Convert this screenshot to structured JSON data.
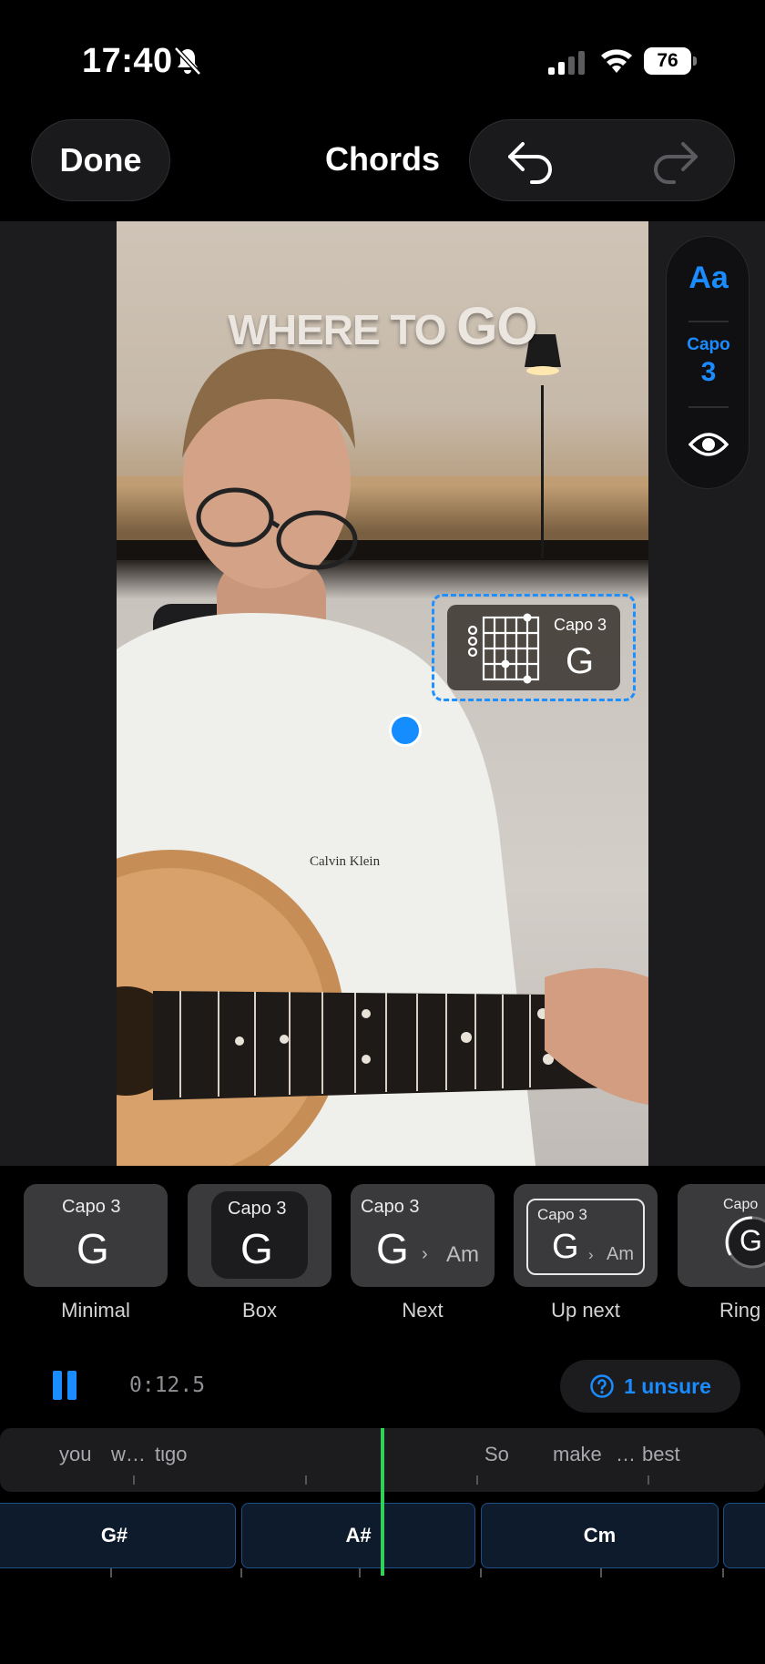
{
  "status": {
    "time": "17:40",
    "battery": "76"
  },
  "header": {
    "done_label": "Done",
    "title": "Chords"
  },
  "video": {
    "caption_small": "WHERE TO",
    "caption_big": "GO"
  },
  "overlay": {
    "capo": "Capo 3",
    "chord": "G"
  },
  "side_panel": {
    "font_label": "Aa",
    "capo_label": "Capo",
    "capo_value": "3"
  },
  "styles": [
    {
      "label": "Minimal",
      "capo": "Capo 3",
      "chord": "G"
    },
    {
      "label": "Box",
      "capo": "Capo 3",
      "chord": "G"
    },
    {
      "label": "Next",
      "capo": "Capo 3",
      "chord": "G",
      "arrow": "›",
      "next": "Am"
    },
    {
      "label": "Up next",
      "capo": "Capo 3",
      "chord": "G",
      "arrow": "›",
      "next": "Am"
    },
    {
      "label": "Ring",
      "capo": "Capo",
      "chord": "G"
    }
  ],
  "playback": {
    "time": "0:12.5",
    "unsure_label": "1 unsure",
    "is_playing": true
  },
  "lyrics": [
    "you",
    "w…",
    "tιgo",
    "So",
    "make",
    "…",
    "best"
  ],
  "chords": [
    "G#",
    "A#",
    "Cm"
  ],
  "colors": {
    "accent": "#1a8cff",
    "playhead": "#2fd158",
    "chord_block": "#0e1b2d"
  }
}
